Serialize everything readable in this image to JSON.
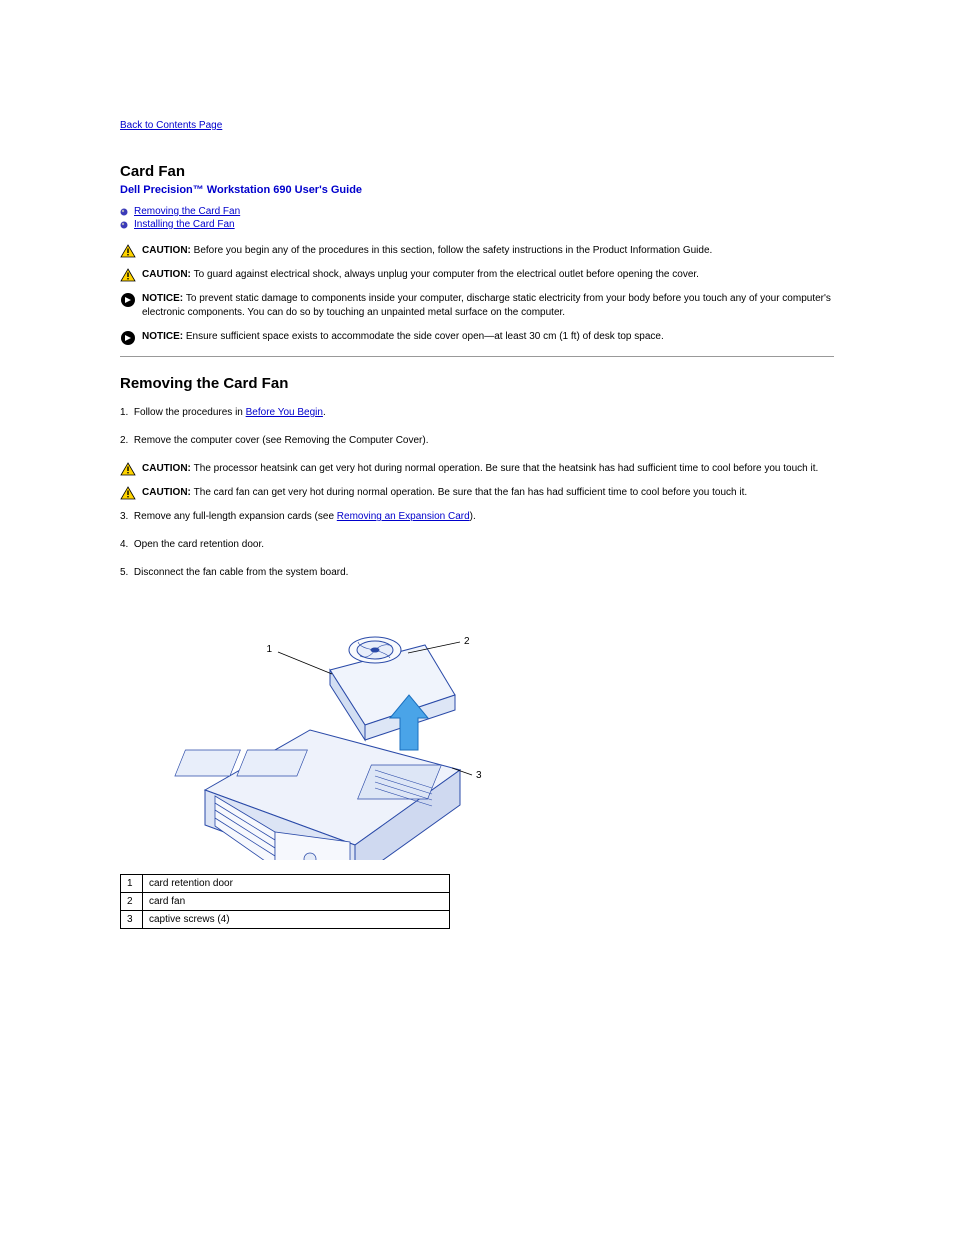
{
  "nav": {
    "back": "Back to Contents Page"
  },
  "header": {
    "title": "Card Fan",
    "subtitle": "Dell Precision™ Workstation 690 User's Guide"
  },
  "toc": {
    "items": [
      {
        "label": "Removing the Card Fan"
      },
      {
        "label": "Installing the Card Fan"
      }
    ]
  },
  "warnings_top": [
    {
      "type": "caution",
      "bold": "CAUTION: ",
      "text": "Before you begin any of the procedures in this section, follow the safety instructions in the Product Information Guide."
    },
    {
      "type": "caution",
      "bold": "CAUTION: ",
      "text": "To guard against electrical shock, always unplug your computer from the electrical outlet before opening the cover."
    },
    {
      "type": "notice",
      "bold": "NOTICE: ",
      "text": "To prevent static damage to components inside your computer, discharge static electricity from your body before you touch any of your computer's electronic components. You can do so by touching an unpainted metal surface on the computer."
    },
    {
      "type": "notice",
      "bold": "NOTICE: ",
      "text": "Ensure sufficient space exists to accommodate the side cover open—at least 30 cm (1 ft) of desk top space."
    }
  ],
  "section": {
    "heading": "Removing the Card Fan"
  },
  "steps": {
    "s1_label": "1.",
    "s1_pre": "Follow the procedures in ",
    "s1_link": "Before You Begin",
    "s1_post": ".",
    "s2_label": "2.",
    "s2_text": "Remove the computer cover (see Removing the Computer Cover)."
  },
  "warnings_mid": [
    {
      "type": "caution",
      "bold": "CAUTION: ",
      "text": "The processor heatsink can get very hot during normal operation. Be sure that the heatsink has had sufficient time to cool before you touch it."
    },
    {
      "type": "caution",
      "bold": "CAUTION: ",
      "text": "The card fan can get very hot during normal operation. Be sure that the fan has had sufficient time to cool before you touch it."
    }
  ],
  "steps2": {
    "s3_label": "3.",
    "s3_pre": "Remove any full-length expansion cards (see ",
    "s3_link": "Removing an Expansion Card",
    "s3_post": ").",
    "s4_label": "4.",
    "s4_text": "Open the card retention door.",
    "s5_label": "5.",
    "s5_text": "Disconnect the fan cable from the system board."
  },
  "callouts": [
    {
      "n": "1",
      "label": "card retention door"
    },
    {
      "n": "2",
      "label": "card fan"
    },
    {
      "n": "3",
      "label": "captive screws (4)"
    }
  ]
}
